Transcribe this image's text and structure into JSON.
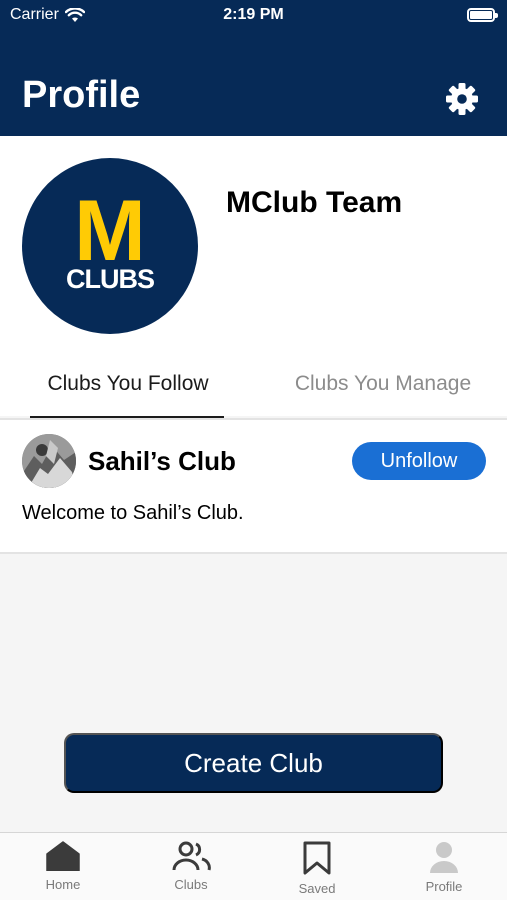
{
  "status_bar": {
    "carrier": "Carrier",
    "time": "2:19 PM"
  },
  "header": {
    "title": "Profile"
  },
  "profile": {
    "logo_letter": "M",
    "logo_text": "CLUBS",
    "name": "MClub Team"
  },
  "tabs": [
    {
      "label": "Clubs You Follow",
      "selected": true
    },
    {
      "label": "Clubs You Manage",
      "selected": false
    }
  ],
  "clubs": [
    {
      "name": "Sahil’s Club",
      "action_label": "Unfollow",
      "description": "Welcome to Sahil’s Club."
    }
  ],
  "create_button": {
    "label": "Create Club"
  },
  "tab_bar": [
    {
      "label": "Home",
      "icon": "home-icon"
    },
    {
      "label": "Clubs",
      "icon": "people-icon"
    },
    {
      "label": "Saved",
      "icon": "bookmark-icon"
    },
    {
      "label": "Profile",
      "icon": "person-icon"
    }
  ],
  "colors": {
    "navy": "#062a57",
    "maize": "#ffcb05",
    "action_blue": "#1a6fd4"
  }
}
